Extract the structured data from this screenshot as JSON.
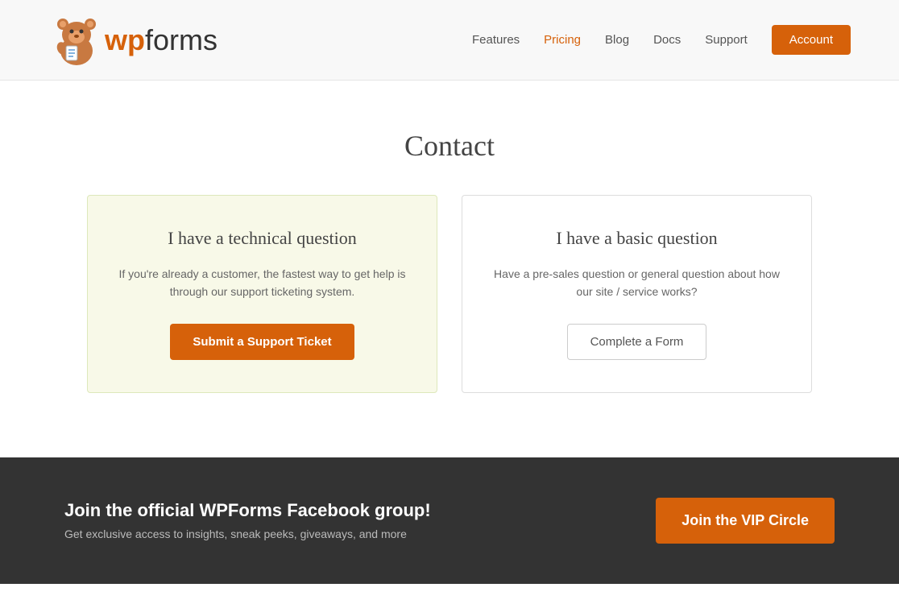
{
  "header": {
    "logo_text_wp": "wp",
    "logo_text_forms": "forms",
    "nav": {
      "features": "Features",
      "pricing": "Pricing",
      "blog": "Blog",
      "docs": "Docs",
      "support": "Support",
      "account": "Account"
    }
  },
  "main": {
    "page_title": "Contact",
    "card_technical": {
      "heading": "I have a technical question",
      "description": "If you're already a customer, the fastest way to get help is through our support ticketing system.",
      "button_label": "Submit a Support Ticket"
    },
    "card_basic": {
      "heading": "I have a basic question",
      "description": "Have a pre-sales question or general question about how our site / service works?",
      "button_label": "Complete a Form"
    }
  },
  "footer": {
    "banner_heading": "Join the official WPForms Facebook group!",
    "banner_sub": "Get exclusive access to insights, sneak peeks, giveaways, and more",
    "vip_button": "Join the VIP Circle"
  },
  "colors": {
    "orange": "#d6610a",
    "dark_bg": "#333333"
  }
}
